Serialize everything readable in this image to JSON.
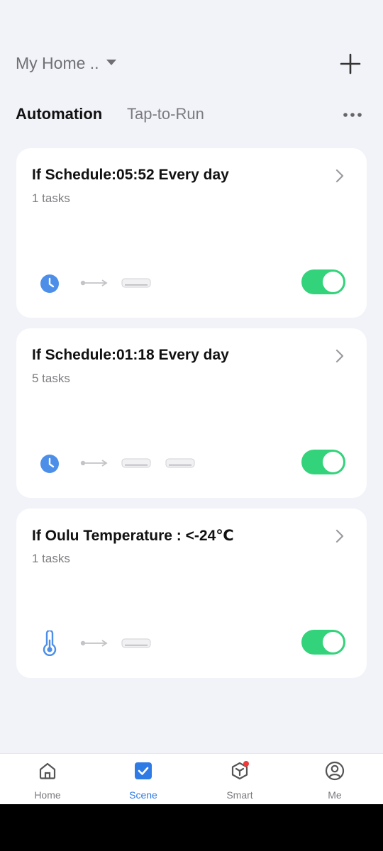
{
  "header": {
    "home_name": "My Home ..",
    "icons": {
      "dropdown": "caret-down-icon",
      "add": "plus-icon"
    }
  },
  "tabs": {
    "automation_label": "Automation",
    "tap_to_run_label": "Tap-to-Run",
    "more_icon": "more-horizontal-icon"
  },
  "cards": [
    {
      "title": "If Schedule:05:52 Every day",
      "tasks": "1 tasks",
      "condition_icon": "clock-icon",
      "device_count": 1,
      "enabled": true
    },
    {
      "title": "If Schedule:01:18 Every day",
      "tasks": "5 tasks",
      "condition_icon": "clock-icon",
      "device_count": 2,
      "enabled": true
    },
    {
      "title": "If Oulu Temperature : <-24℃",
      "tasks": "1 tasks",
      "condition_icon": "thermometer-icon",
      "device_count": 1,
      "enabled": true
    }
  ],
  "nav": {
    "home": "Home",
    "scene": "Scene",
    "smart": "Smart",
    "me": "Me",
    "active": "Scene",
    "smart_has_badge": true
  },
  "colors": {
    "background": "#f2f3f8",
    "accent": "#2f7be6",
    "toggle_on": "#33d37b",
    "badge": "#f03a3a",
    "condition_icon": "#4d8fe8"
  }
}
